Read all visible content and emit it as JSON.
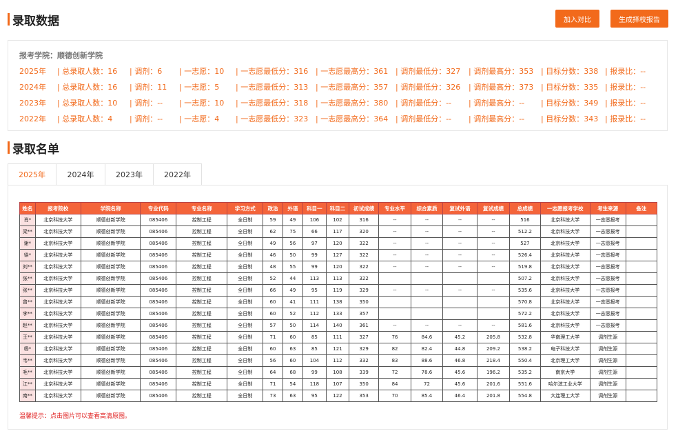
{
  "header": {
    "title": "录取数据",
    "compare_button": "加入对比",
    "report_button": "生成择校报告"
  },
  "stats": {
    "school": "报考学院：顺德创新学院",
    "rows": [
      {
        "year": "2025年",
        "total": "总录取人数：16",
        "adjust": "调剂：6",
        "first": "一志愿：10",
        "first_min": "一志愿最低分：316",
        "first_max": "一志愿最高分：361",
        "adj_min": "调剂最低分：327",
        "adj_max": "调剂最高分：353",
        "target": "目标分数：338",
        "ratio": "报录比：--"
      },
      {
        "year": "2024年",
        "total": "总录取人数：16",
        "adjust": "调剂：11",
        "first": "一志愿：5",
        "first_min": "一志愿最低分：313",
        "first_max": "一志愿最高分：357",
        "adj_min": "调剂最低分：326",
        "adj_max": "调剂最高分：373",
        "target": "目标分数：335",
        "ratio": "报录比：--"
      },
      {
        "year": "2023年",
        "total": "总录取人数：10",
        "adjust": "调剂：--",
        "first": "一志愿：10",
        "first_min": "一志愿最低分：318",
        "first_max": "一志愿最高分：380",
        "adj_min": "调剂最低分：--",
        "adj_max": "调剂最高分：--",
        "target": "目标分数：349",
        "ratio": "报录比：--"
      },
      {
        "year": "2022年",
        "total": "总录取人数：4",
        "adjust": "调剂：--",
        "first": "一志愿：4",
        "first_min": "一志愿最低分：323",
        "first_max": "一志愿最高分：364",
        "adj_min": "调剂最低分：--",
        "adj_max": "调剂最高分：--",
        "target": "目标分数：343",
        "ratio": "报录比：--"
      }
    ]
  },
  "list": {
    "title": "录取名单",
    "tabs": [
      "2025年",
      "2024年",
      "2023年",
      "2022年"
    ],
    "active_tab": "2025年",
    "columns": [
      "姓名",
      "报考院校",
      "学院名称",
      "专业代码",
      "专业名称",
      "学习方式",
      "政治",
      "外语",
      "科目一",
      "科目二",
      "初试成绩",
      "专业水平",
      "综合素质",
      "复试外语",
      "复试成绩",
      "总成绩",
      "一志愿报考学校",
      "考生来源",
      "备注"
    ],
    "rows": [
      [
        "肖*",
        "北京科技大学",
        "顺德创新学院",
        "085406",
        "控制工程",
        "全日制",
        "59",
        "49",
        "106",
        "102",
        "316",
        "--",
        "--",
        "--",
        "--",
        "516",
        "北京科技大学",
        "一志愿报考",
        ""
      ],
      [
        "梁**",
        "北京科技大学",
        "顺德创新学院",
        "085406",
        "控制工程",
        "全日制",
        "62",
        "75",
        "66",
        "117",
        "320",
        "--",
        "--",
        "--",
        "--",
        "512.2",
        "北京科技大学",
        "一志愿报考",
        ""
      ],
      [
        "谢*",
        "北京科技大学",
        "顺德创新学院",
        "085406",
        "控制工程",
        "全日制",
        "49",
        "56",
        "97",
        "120",
        "322",
        "--",
        "--",
        "--",
        "--",
        "527",
        "北京科技大学",
        "一志愿报考",
        ""
      ],
      [
        "徐*",
        "北京科技大学",
        "顺德创新学院",
        "085406",
        "控制工程",
        "全日制",
        "46",
        "50",
        "99",
        "127",
        "322",
        "--",
        "--",
        "--",
        "--",
        "526.4",
        "北京科技大学",
        "一志愿报考",
        ""
      ],
      [
        "刘**",
        "北京科技大学",
        "顺德创新学院",
        "085406",
        "控制工程",
        "全日制",
        "48",
        "55",
        "99",
        "120",
        "322",
        "--",
        "--",
        "--",
        "--",
        "519.8",
        "北京科技大学",
        "一志愿报考",
        ""
      ],
      [
        "张**",
        "北京科技大学",
        "顺德创新学院",
        "085406",
        "控制工程",
        "全日制",
        "52",
        "44",
        "113",
        "113",
        "322",
        "",
        "",
        "",
        "",
        "507.2",
        "北京科技大学",
        "一志愿报考",
        ""
      ],
      [
        "张**",
        "北京科技大学",
        "顺德创新学院",
        "085406",
        "控制工程",
        "全日制",
        "66",
        "49",
        "95",
        "119",
        "329",
        "--",
        "--",
        "--",
        "--",
        "535.6",
        "北京科技大学",
        "一志愿报考",
        ""
      ],
      [
        "曾**",
        "北京科技大学",
        "顺德创新学院",
        "085406",
        "控制工程",
        "全日制",
        "60",
        "41",
        "111",
        "138",
        "350",
        "",
        "",
        "",
        "",
        "570.8",
        "北京科技大学",
        "一志愿报考",
        ""
      ],
      [
        "李**",
        "北京科技大学",
        "顺德创新学院",
        "085406",
        "控制工程",
        "全日制",
        "60",
        "52",
        "112",
        "133",
        "357",
        "",
        "",
        "",
        "",
        "572.2",
        "北京科技大学",
        "一志愿报考",
        ""
      ],
      [
        "赵**",
        "北京科技大学",
        "顺德创新学院",
        "085406",
        "控制工程",
        "全日制",
        "57",
        "50",
        "114",
        "140",
        "361",
        "--",
        "--",
        "--",
        "--",
        "581.6",
        "北京科技大学",
        "一志愿报考",
        ""
      ],
      [
        "王**",
        "北京科技大学",
        "顺德创新学院",
        "085406",
        "控制工程",
        "全日制",
        "71",
        "60",
        "85",
        "111",
        "327",
        "76",
        "84.6",
        "45.2",
        "205.8",
        "532.8",
        "华南理工大学",
        "调剂生源",
        ""
      ],
      [
        "杨*",
        "北京科技大学",
        "顺德创新学院",
        "085406",
        "控制工程",
        "全日制",
        "60",
        "63",
        "85",
        "121",
        "329",
        "82",
        "82.4",
        "44.8",
        "209.2",
        "538.2",
        "电子科技大学",
        "调剂生源",
        ""
      ],
      [
        "韦**",
        "北京科技大学",
        "顺德创新学院",
        "085406",
        "控制工程",
        "全日制",
        "56",
        "60",
        "104",
        "112",
        "332",
        "83",
        "88.6",
        "46.8",
        "218.4",
        "550.4",
        "北京理工大学",
        "调剂生源",
        ""
      ],
      [
        "毛**",
        "北京科技大学",
        "顺德创新学院",
        "085406",
        "控制工程",
        "全日制",
        "64",
        "68",
        "99",
        "108",
        "339",
        "72",
        "78.6",
        "45.6",
        "196.2",
        "535.2",
        "南京大学",
        "调剂生源",
        ""
      ],
      [
        "江**",
        "北京科技大学",
        "顺德创新学院",
        "085406",
        "控制工程",
        "全日制",
        "71",
        "54",
        "118",
        "107",
        "350",
        "84",
        "72",
        "45.6",
        "201.6",
        "551.6",
        "哈尔滨工业大学",
        "调剂生源",
        ""
      ],
      [
        "南**",
        "北京科技大学",
        "顺德创新学院",
        "085406",
        "控制工程",
        "全日制",
        "73",
        "63",
        "95",
        "122",
        "353",
        "70",
        "85.4",
        "46.4",
        "201.8",
        "554.8",
        "大连理工大学",
        "调剂生源",
        ""
      ]
    ],
    "tip": "温馨提示：点击图片可以查看高清原图。"
  }
}
